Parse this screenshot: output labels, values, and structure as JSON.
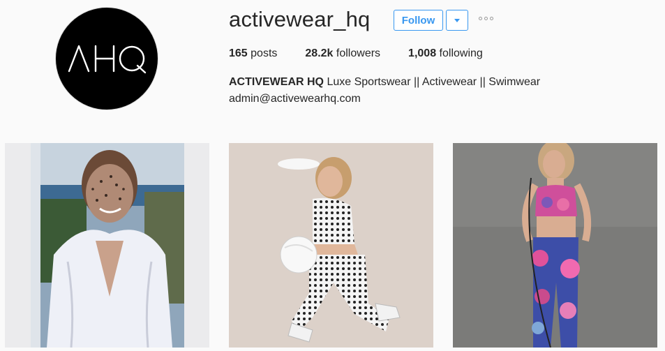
{
  "profile": {
    "username": "activewear_hq",
    "avatar_text": "AHQ",
    "follow_label": "Follow"
  },
  "stats": {
    "posts_count": "165",
    "posts_label": "posts",
    "followers_count": "28.2k",
    "followers_label": "followers",
    "following_count": "1,008",
    "following_label": "following"
  },
  "bio": {
    "name": "ACTIVEWEAR HQ",
    "description": "Luxe Sportswear || Activewear || Swimwear",
    "email": "admin@activewearhq.com"
  },
  "posts": [
    {
      "icon": "photo-woman-face-mask-bathrobe"
    },
    {
      "icon": "photo-woman-visor-polka-dot-ball"
    },
    {
      "icon": "photo-woman-floral-leggings-jumprope"
    }
  ],
  "colors": {
    "accent": "#3897f0",
    "text": "#262626",
    "background": "#fafafa"
  }
}
